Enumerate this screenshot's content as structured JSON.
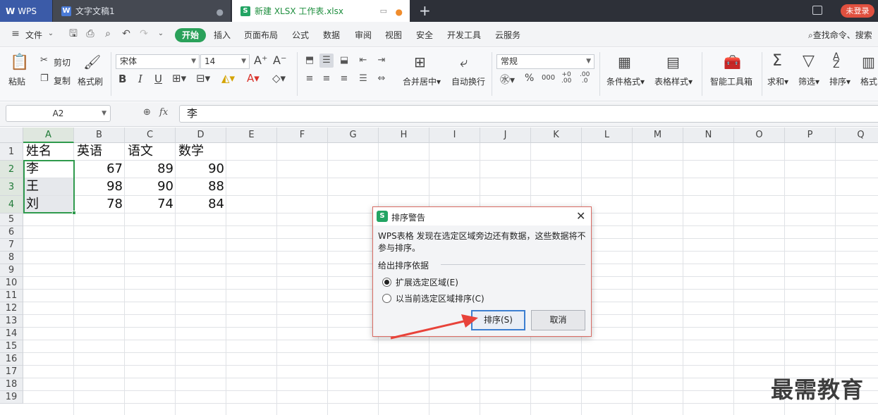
{
  "titlebar": {
    "tabs": [
      {
        "label": "WPS"
      },
      {
        "label": "文字文稿1"
      },
      {
        "label": "新建 XLSX 工作表.xlsx"
      }
    ],
    "new_tab": "+",
    "login": "未登录"
  },
  "menu": {
    "file": "文件",
    "start": "开始",
    "items": [
      "插入",
      "页面布局",
      "公式",
      "数据",
      "审阅",
      "视图",
      "安全",
      "开发工具",
      "云服务"
    ],
    "search": "查找命令、搜索"
  },
  "ribbon": {
    "paste": "粘贴",
    "cut": "剪切",
    "copy": "复制",
    "format_painter": "格式刷",
    "font_name": "宋体",
    "font_size": "14",
    "merge_center": "合并居中",
    "wrap_text": "自动换行",
    "number_format": "常规",
    "conditional_format": "条件格式",
    "table_style": "表格样式",
    "smart_toolbox": "智能工具箱",
    "sum": "求和",
    "filter": "筛选",
    "sort": "排序",
    "format": "格式"
  },
  "formula_bar": {
    "cell_ref": "A2",
    "fx": "fx",
    "value": "李"
  },
  "sheet": {
    "columns": [
      "A",
      "B",
      "C",
      "D",
      "E",
      "F",
      "G",
      "H",
      "I",
      "J",
      "K",
      "L",
      "M",
      "N",
      "O",
      "P",
      "Q"
    ],
    "rows": [
      "1",
      "2",
      "3",
      "4",
      "5",
      "6",
      "7",
      "8",
      "9",
      "10",
      "11",
      "12",
      "13",
      "14",
      "15",
      "16",
      "17",
      "18",
      "19"
    ],
    "header": [
      "姓名",
      "英语",
      "语文",
      "数学"
    ],
    "data": [
      [
        "李",
        "67",
        "89",
        "90"
      ],
      [
        "王",
        "98",
        "90",
        "88"
      ],
      [
        "刘",
        "78",
        "74",
        "84"
      ]
    ]
  },
  "dialog": {
    "title": "排序警告",
    "message": "WPS表格 发现在选定区域旁边还有数据，这些数据将不参与排序。",
    "group_label": "给出排序依据",
    "option_expand": "扩展选定区域(E)",
    "option_current": "以当前选定区域排序(C)",
    "sort_button": "排序(S)",
    "cancel_button": "取消"
  },
  "watermark": "最需教育",
  "colors": {
    "accent_green": "#2aa15a",
    "wps_blue": "#3b5ba8",
    "login_red": "#e0503f",
    "arrow_red": "#e8433a"
  }
}
